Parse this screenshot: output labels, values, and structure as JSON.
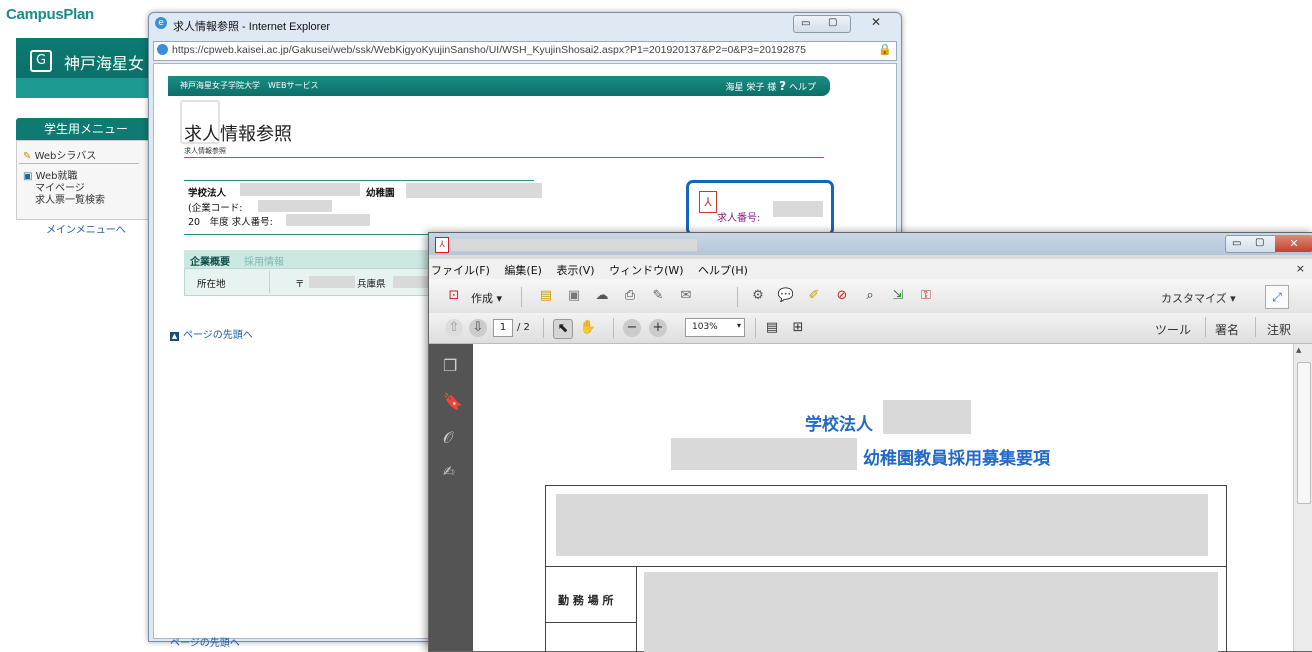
{
  "portal": {
    "logo": "CampusPlan",
    "banner_title": "神戸海星女",
    "menu_header": "学生用メニュー",
    "items": [
      "Webシラバス",
      "Web就職",
      "マイページ",
      "求人票一覧検索"
    ],
    "main_menu_link": "メインメニューへ"
  },
  "ie": {
    "title": "求人情報参照 - Internet Explorer",
    "url": "https://cpweb.kaisei.ac.jp/Gakusei/web/ssk/WebKigyoKyujinSansho/UI/WSH_KyujinShosai2.aspx?P1=201920137&P2=0&P3=20192875",
    "header_left": "神戸海星女子学院大学　WEBサービス",
    "header_user": "海星 栄子 様",
    "header_help": "ヘルプ",
    "page_title": "求人情報参照",
    "page_subtitle": "求人情報参照",
    "school_label": "学校法人",
    "kindergarten_label": "幼稚園",
    "company_code_label": "(企業コード:",
    "job_number_line": "20　年度 求人番号:",
    "job_number_link": "求人番号:",
    "tab_overview": "企業概要",
    "tab_hiring": "採用情報",
    "address_label": "所在地",
    "postal_mark": "〒",
    "prefecture": "兵庫県",
    "back_to_top": "ページの先頭へ",
    "back_to_top_bottom": "ページの先頭へ"
  },
  "reader": {
    "menu": [
      "ファイル(F)",
      "編集(E)",
      "表示(V)",
      "ウィンドウ(W)",
      "ヘルプ(H)"
    ],
    "create_label": "作成",
    "customize_label": "カスタマイズ",
    "page_current": "1",
    "page_total": "/ 2",
    "zoom": "103%",
    "tools": "ツール",
    "sign": "署名",
    "comment": "注釈",
    "doc_line1": "学校法人",
    "doc_line2": "幼稚園教員採用募集要項",
    "workplace_label": "勤 務 場 所"
  },
  "colors": {
    "accent": "#1565c0",
    "teal": "#0e7a71",
    "doc_blue": "#2469c6"
  }
}
